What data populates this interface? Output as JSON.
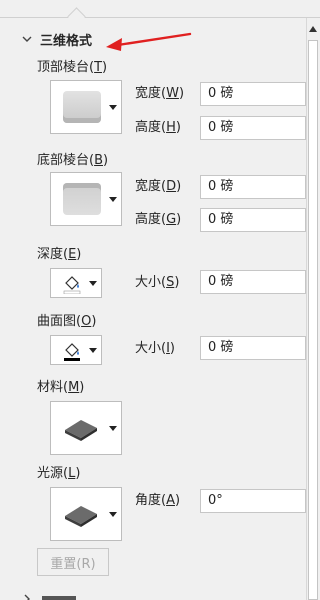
{
  "section": {
    "chevron": "chevron-down-icon",
    "title": "三维格式"
  },
  "annotation": {
    "arrow_color": "#e02020"
  },
  "top_bevel": {
    "label": "顶部棱台(",
    "key": "T",
    "tail": ")"
  },
  "bottom_bevel": {
    "label": "底部棱台(",
    "key": "B",
    "tail": ")"
  },
  "top_width": {
    "label": "宽度(",
    "key": "W",
    "tail": ")",
    "value": "0 磅"
  },
  "top_height": {
    "label": "高度(",
    "key": "H",
    "tail": ")",
    "value": "0 磅"
  },
  "bottom_width": {
    "label": "宽度(",
    "key": "D",
    "tail": ")",
    "value": "0 磅"
  },
  "bottom_height": {
    "label": "高度(",
    "key": "G",
    "tail": ")",
    "value": "0 磅"
  },
  "depth": {
    "label": "深度(",
    "key": "E",
    "tail": ")",
    "size_label": "大小(",
    "size_key": "S",
    "size_tail": ")",
    "value": "0 磅"
  },
  "contour": {
    "label": "曲面图(",
    "key": "O",
    "tail": ")",
    "size_label": "大小(",
    "size_key": "I",
    "size_tail": ")",
    "value": "0 磅"
  },
  "material": {
    "label": "材料(",
    "key": "M",
    "tail": ")"
  },
  "lighting": {
    "label": "光源(",
    "key": "L",
    "tail": ")",
    "angle_label": "角度(",
    "angle_key": "A",
    "angle_tail": ")",
    "value": "0°"
  },
  "reset": {
    "label": "重置(R)"
  },
  "colors": {
    "panel": "#f0f0f0",
    "accent_arrow": "#e02020"
  }
}
